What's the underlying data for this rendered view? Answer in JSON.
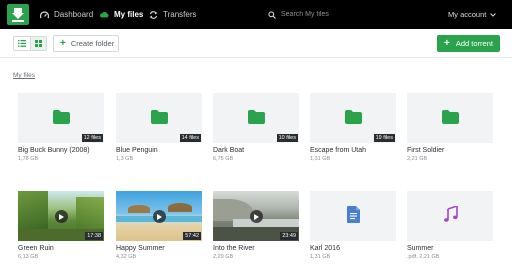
{
  "nav": {
    "items": [
      {
        "label": "Dashboard",
        "icon": "speedometer-icon",
        "active": false
      },
      {
        "label": "My files",
        "icon": "cloud-icon",
        "active": true
      },
      {
        "label": "Transfers",
        "icon": "transfer-arrows-icon",
        "active": false
      }
    ],
    "search_placeholder": "Search My files",
    "account_label": "My account"
  },
  "toolbar": {
    "create_folder_label": "Create folder",
    "add_torrent_label": "Add torrent"
  },
  "breadcrumb": "My files",
  "colors": {
    "accent": "#2ba24c",
    "topbar": "#000000",
    "card_bg": "#f1f3f5",
    "audio": "#a646c2",
    "document": "#4a7fd0"
  },
  "files": [
    {
      "name": "Big Buck Bunny (2008)",
      "meta": "1,78 GB",
      "type": "folder",
      "badge": "12 files"
    },
    {
      "name": "Blue Penguin",
      "meta": "1,3 GB",
      "type": "folder",
      "badge": "14 files"
    },
    {
      "name": "Dark Boat",
      "meta": "6,75 GB",
      "type": "folder",
      "badge": "10 files"
    },
    {
      "name": "Escape from Utah",
      "meta": "1,31 GB",
      "type": "folder",
      "badge": "19 files"
    },
    {
      "name": "First Soldier",
      "meta": "2,21 GB",
      "type": "folder",
      "badge": ""
    },
    {
      "name": "Green Ruin",
      "meta": "6,13 GB",
      "type": "video",
      "badge": "17:38"
    },
    {
      "name": "Happy Summer",
      "meta": "4,32 GB",
      "type": "video",
      "badge": "57:42"
    },
    {
      "name": "Into the River",
      "meta": "2,29 GB",
      "type": "video",
      "badge": "23:49"
    },
    {
      "name": "Karl 2016",
      "meta": "1,31 GB",
      "type": "document",
      "badge": ""
    },
    {
      "name": "Summer",
      "meta": ".pdf, 2,21 GB",
      "type": "audio",
      "badge": ""
    }
  ]
}
